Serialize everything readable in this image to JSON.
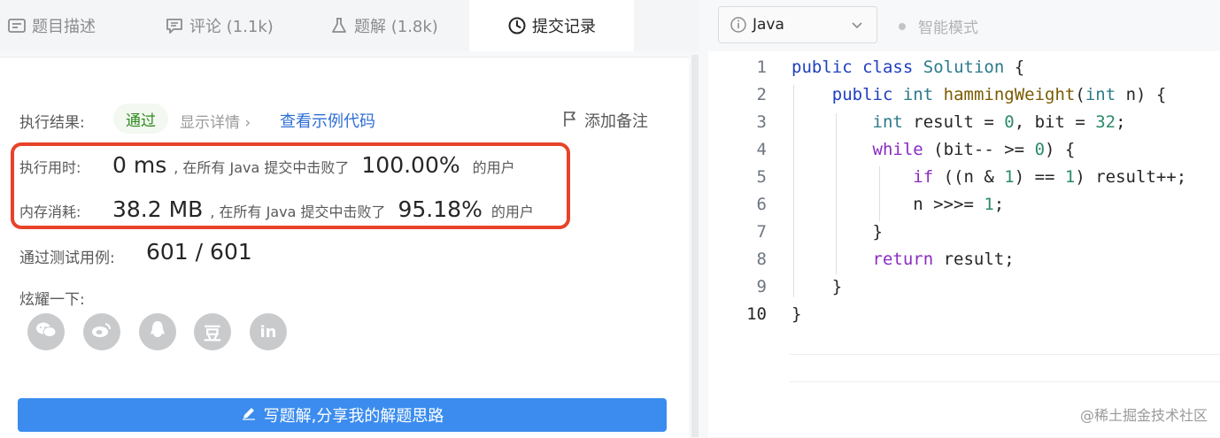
{
  "tabs": [
    {
      "label": "题目描述",
      "icon": "description-icon"
    },
    {
      "label": "评论 (1.1k)",
      "icon": "comment-icon"
    },
    {
      "label": "题解 (1.8k)",
      "icon": "flask-icon"
    },
    {
      "label": "提交记录",
      "icon": "clock-icon",
      "active": true
    }
  ],
  "result": {
    "label": "执行结果:",
    "status": "通过",
    "details_link": "显示详情 ›",
    "example_link": "查看示例代码",
    "note_button": "添加备注"
  },
  "stats": {
    "runtime": {
      "label": "执行用时:",
      "value": "0 ms",
      "middle": ", 在所有 Java 提交中击败了",
      "percent": "100.00%",
      "suffix": "的用户"
    },
    "memory": {
      "label": "内存消耗:",
      "value": "38.2 MB",
      "middle": ", 在所有 Java 提交中击败了",
      "percent": "95.18%",
      "suffix": "的用户"
    }
  },
  "testcases": {
    "label": "通过测试用例:",
    "value": "601 / 601"
  },
  "share": {
    "label": "炫耀一下:",
    "buttons": [
      {
        "name": "wechat-icon",
        "glyph": ""
      },
      {
        "name": "weibo-icon",
        "glyph": ""
      },
      {
        "name": "qq-icon",
        "glyph": ""
      },
      {
        "name": "douban-icon",
        "glyph": "豆"
      },
      {
        "name": "linkedin-icon",
        "glyph": "in"
      }
    ]
  },
  "write_solution": "写题解,分享我的解题思路",
  "editor": {
    "language": "Java",
    "smart_mode": "智能模式",
    "line_numbers": [
      "1",
      "2",
      "3",
      "4",
      "5",
      "6",
      "7",
      "8",
      "9",
      "10"
    ]
  },
  "watermark": "@稀土掘金技术社区",
  "colors": {
    "accent": "#3b8cee",
    "highlight": "#e8432a",
    "pass": "#2d8a1f"
  }
}
